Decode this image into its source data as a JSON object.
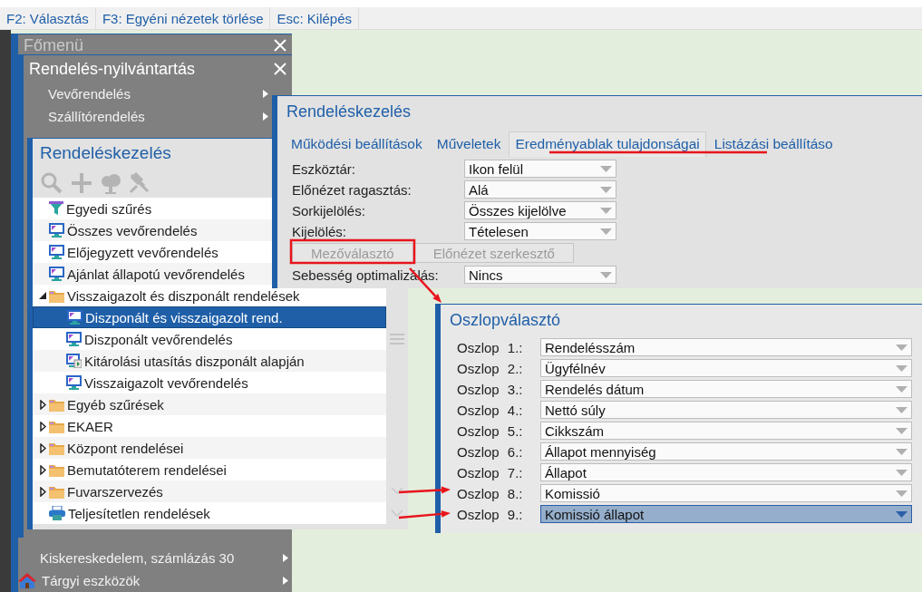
{
  "toolbar": [
    {
      "label": "F2: Választás"
    },
    {
      "label": "F3: Egyéni nézetek törlése"
    },
    {
      "label": "Esc: Kilépés"
    }
  ],
  "main_menu": {
    "title": "Főmenü",
    "items": [
      {
        "label": "Kiskereskedelem, számlázás 30",
        "kind": "plain"
      },
      {
        "label": "Tárgyi eszközök",
        "kind": "with_icon"
      }
    ]
  },
  "order_menu": {
    "title": "Rendelés-nyilvántartás",
    "items": [
      {
        "label": "Vevőrendelés"
      },
      {
        "label": "Szállítórendelés"
      }
    ]
  },
  "tree_window": {
    "title": "Rendeléskezelés",
    "tools": [
      {
        "kind": "search",
        "disabled": true
      },
      {
        "kind": "add",
        "disabled": true
      },
      {
        "kind": "tree",
        "disabled": true
      },
      {
        "kind": "pin",
        "disabled": true
      }
    ],
    "items": [
      {
        "label": "Egyedi szűrés",
        "kind": "filter",
        "selected": false
      },
      {
        "label": "Összes vevőrendelés",
        "kind": "view",
        "selected": false
      },
      {
        "label": "Előjegyzett vevőrendelés",
        "kind": "view",
        "selected": false
      },
      {
        "label": "Ajánlat állapotú vevőrendelés",
        "kind": "view",
        "selected": false
      },
      {
        "label": "Visszaigazolt és diszponált rendelések",
        "kind": "folder",
        "expanded": true,
        "selected": false,
        "children": [
          {
            "label": "Diszponált és visszaigazolt rend.",
            "kind": "view",
            "selected": true
          },
          {
            "label": "Diszponált vevőrendelés",
            "kind": "view",
            "selected": false
          },
          {
            "label": "Kitárolási utasítás diszponált alapján",
            "kind": "view_play",
            "selected": false
          },
          {
            "label": "Visszaigazolt vevőrendelés",
            "kind": "view",
            "selected": false
          }
        ]
      },
      {
        "label": "Egyéb szűrések",
        "kind": "folder",
        "expanded": false,
        "selected": false
      },
      {
        "label": "EKAER",
        "kind": "folder",
        "expanded": false,
        "selected": false
      },
      {
        "label": "Központ rendelései",
        "kind": "folder",
        "expanded": false,
        "selected": false
      },
      {
        "label": "Bemutatóterem rendelései",
        "kind": "folder",
        "expanded": false,
        "selected": false
      },
      {
        "label": "Fuvarszervezés",
        "kind": "folder",
        "expanded": false,
        "selected": false
      },
      {
        "label": "Teljesítetlen rendelések",
        "kind": "print",
        "selected": false
      }
    ]
  },
  "settings_window": {
    "title": "Rendeléskezelés",
    "tabs": [
      {
        "label": "Működési beállítások",
        "selected": false
      },
      {
        "label": "Műveletek",
        "selected": false
      },
      {
        "label": "Eredményablak tulajdonságai",
        "selected": true
      },
      {
        "label": "Listázási beállításo",
        "selected": false
      }
    ],
    "rows": [
      {
        "kind": "select",
        "label": "Eszköztár:",
        "value": "Ikon felül"
      },
      {
        "kind": "select",
        "label": "Előnézet ragasztás:",
        "value": "Alá"
      },
      {
        "kind": "select",
        "label": "Sorkijelölés:",
        "value": "Összes kijelölve"
      },
      {
        "kind": "select",
        "label": "Kijelölés:",
        "value": "Tételesen"
      },
      {
        "kind": "buttons",
        "buttons": [
          {
            "label": "Mezőválasztó",
            "disabled": true
          },
          {
            "label": "Előnézet szerkesztő",
            "disabled": true
          }
        ]
      },
      {
        "kind": "select",
        "label": "Sebesség optimalizálás:",
        "value": "Nincs"
      }
    ]
  },
  "column_chooser": {
    "title": "Oszlopválasztó",
    "columns": [
      {
        "label": "Oszlop 1.:",
        "value": "Rendelésszám",
        "selected": false
      },
      {
        "label": "Oszlop 2.:",
        "value": "Ügyfélnév",
        "selected": false
      },
      {
        "label": "Oszlop 3.:",
        "value": "Rendelés dátum",
        "selected": false
      },
      {
        "label": "Oszlop 4.:",
        "value": "Nettó súly",
        "selected": false
      },
      {
        "label": "Oszlop 5.:",
        "value": "Cikkszám",
        "selected": false
      },
      {
        "label": "Oszlop 6.:",
        "value": "Állapot mennyiség",
        "selected": false
      },
      {
        "label": "Oszlop 7.:",
        "value": "Állapot",
        "selected": false
      },
      {
        "label": "Oszlop 8.:",
        "value": "Komissió",
        "selected": false
      },
      {
        "label": "Oszlop 9.:",
        "value": "Komissió állapot",
        "selected": true
      }
    ]
  }
}
